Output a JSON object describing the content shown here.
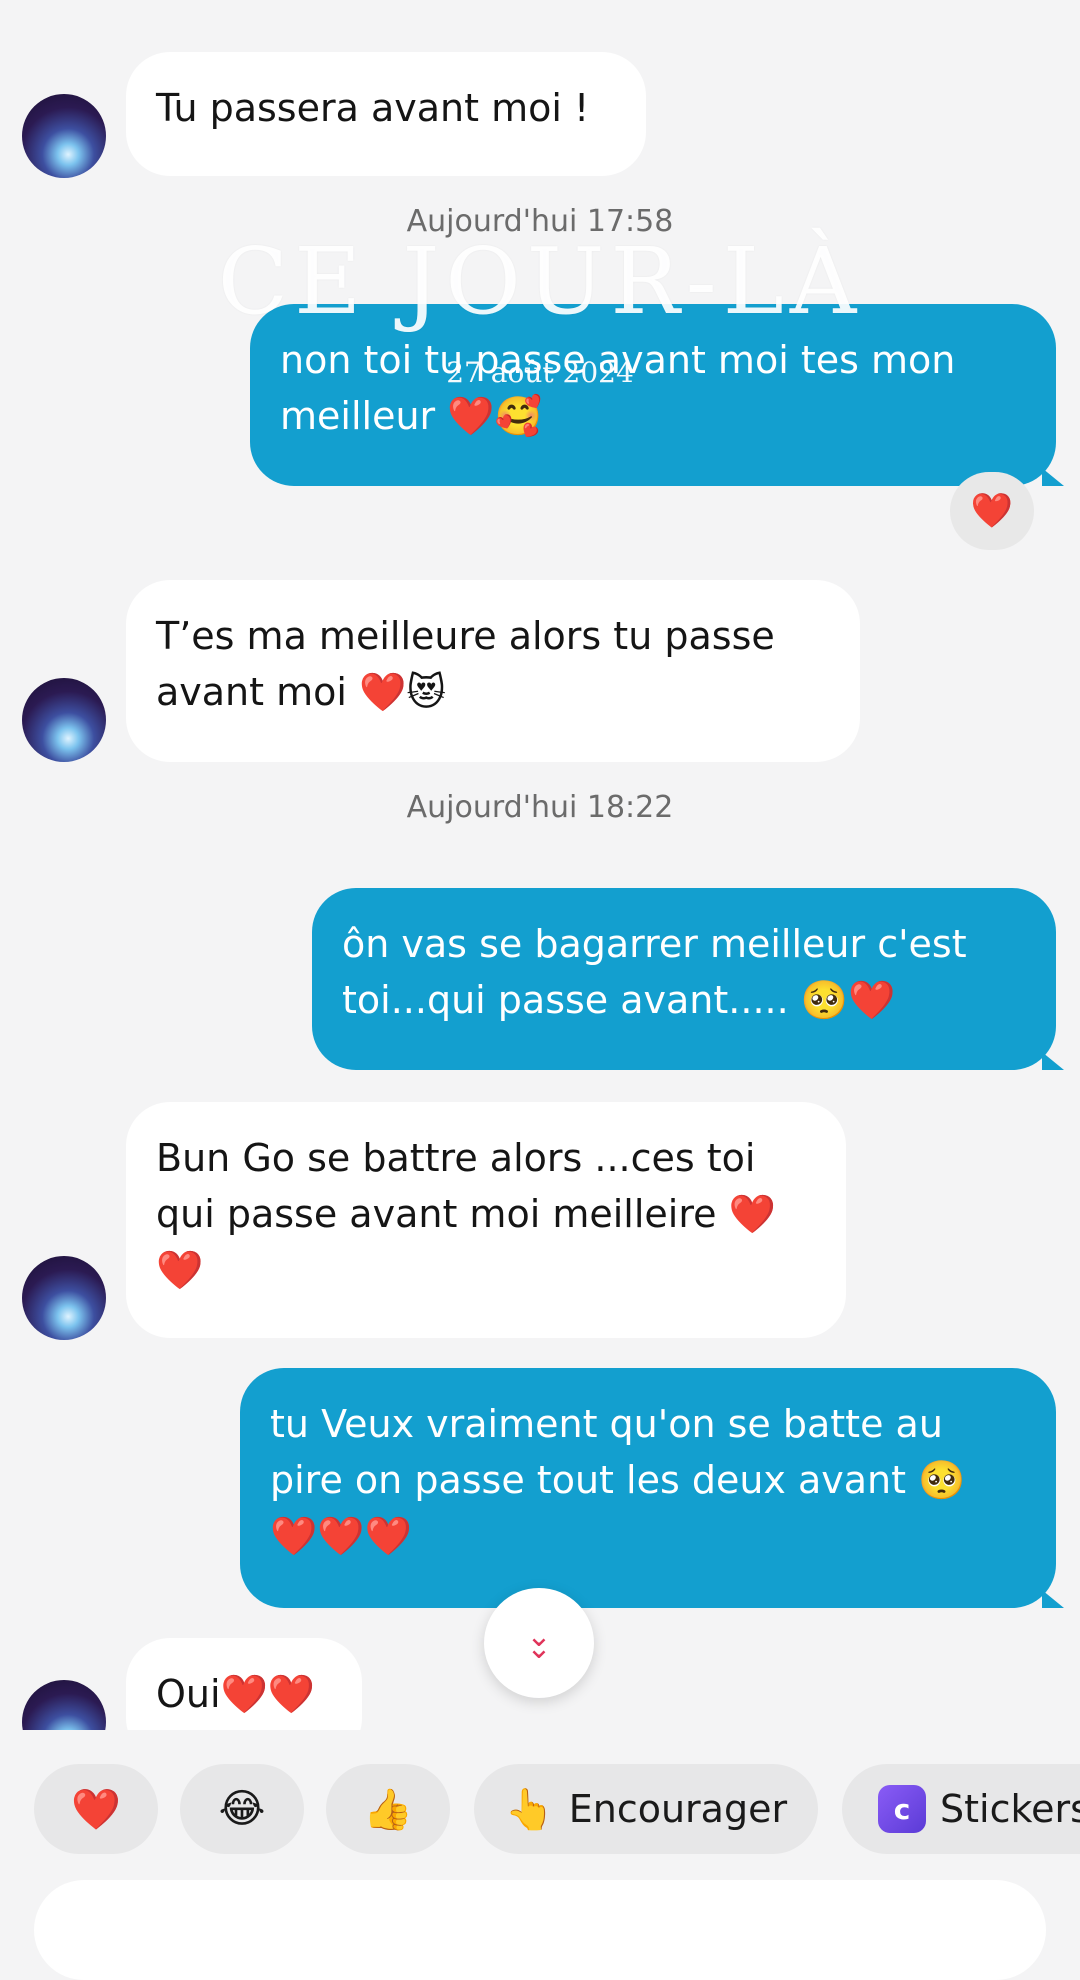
{
  "messages": [
    {
      "side": "in",
      "text": "Tu passera avant moi !"
    },
    {
      "side": "out",
      "text": "non toi tu passe avant moi tes mon\nmeilleur ❤️🥰",
      "reaction": "❤️"
    },
    {
      "side": "in",
      "text": "T’es ma meilleure alors tu passe\navant moi ❤️😻"
    },
    {
      "side": "out",
      "text": "ôn vas se bagarrer meilleur c'est\ntoi...qui passe avant..... 🥺❤️"
    },
    {
      "side": "in",
      "text": "Bun Go se battre alors ...ces toi\nqui passe avant moi meilleire ❤️\n❤️"
    },
    {
      "side": "out",
      "text": "tu Veux vraiment qu'on se batte au\npire on passe tout les deux avant 🥺\n❤️❤️❤️"
    },
    {
      "side": "in",
      "text": "Oui❤️❤️"
    }
  ],
  "timestamps": [
    "Aujourd'hui 17:58",
    "Aujourd'hui 18:22"
  ],
  "overlay": {
    "title": "CE JOUR-LÀ",
    "date": "27 août 2024"
  },
  "quick_replies": [
    {
      "icon": "❤️",
      "label": ""
    },
    {
      "icon": "😂",
      "label": ""
    },
    {
      "icon": "👍",
      "label": ""
    },
    {
      "icon": "👆",
      "label": "Encourager"
    },
    {
      "icon": "sticker-icon",
      "label": "Stickers"
    }
  ],
  "colors": {
    "outgoing_bubble": "#139fcf",
    "incoming_bubble": "#ffffff",
    "background": "#f4f4f5",
    "accent_heart": "#f0385f"
  }
}
